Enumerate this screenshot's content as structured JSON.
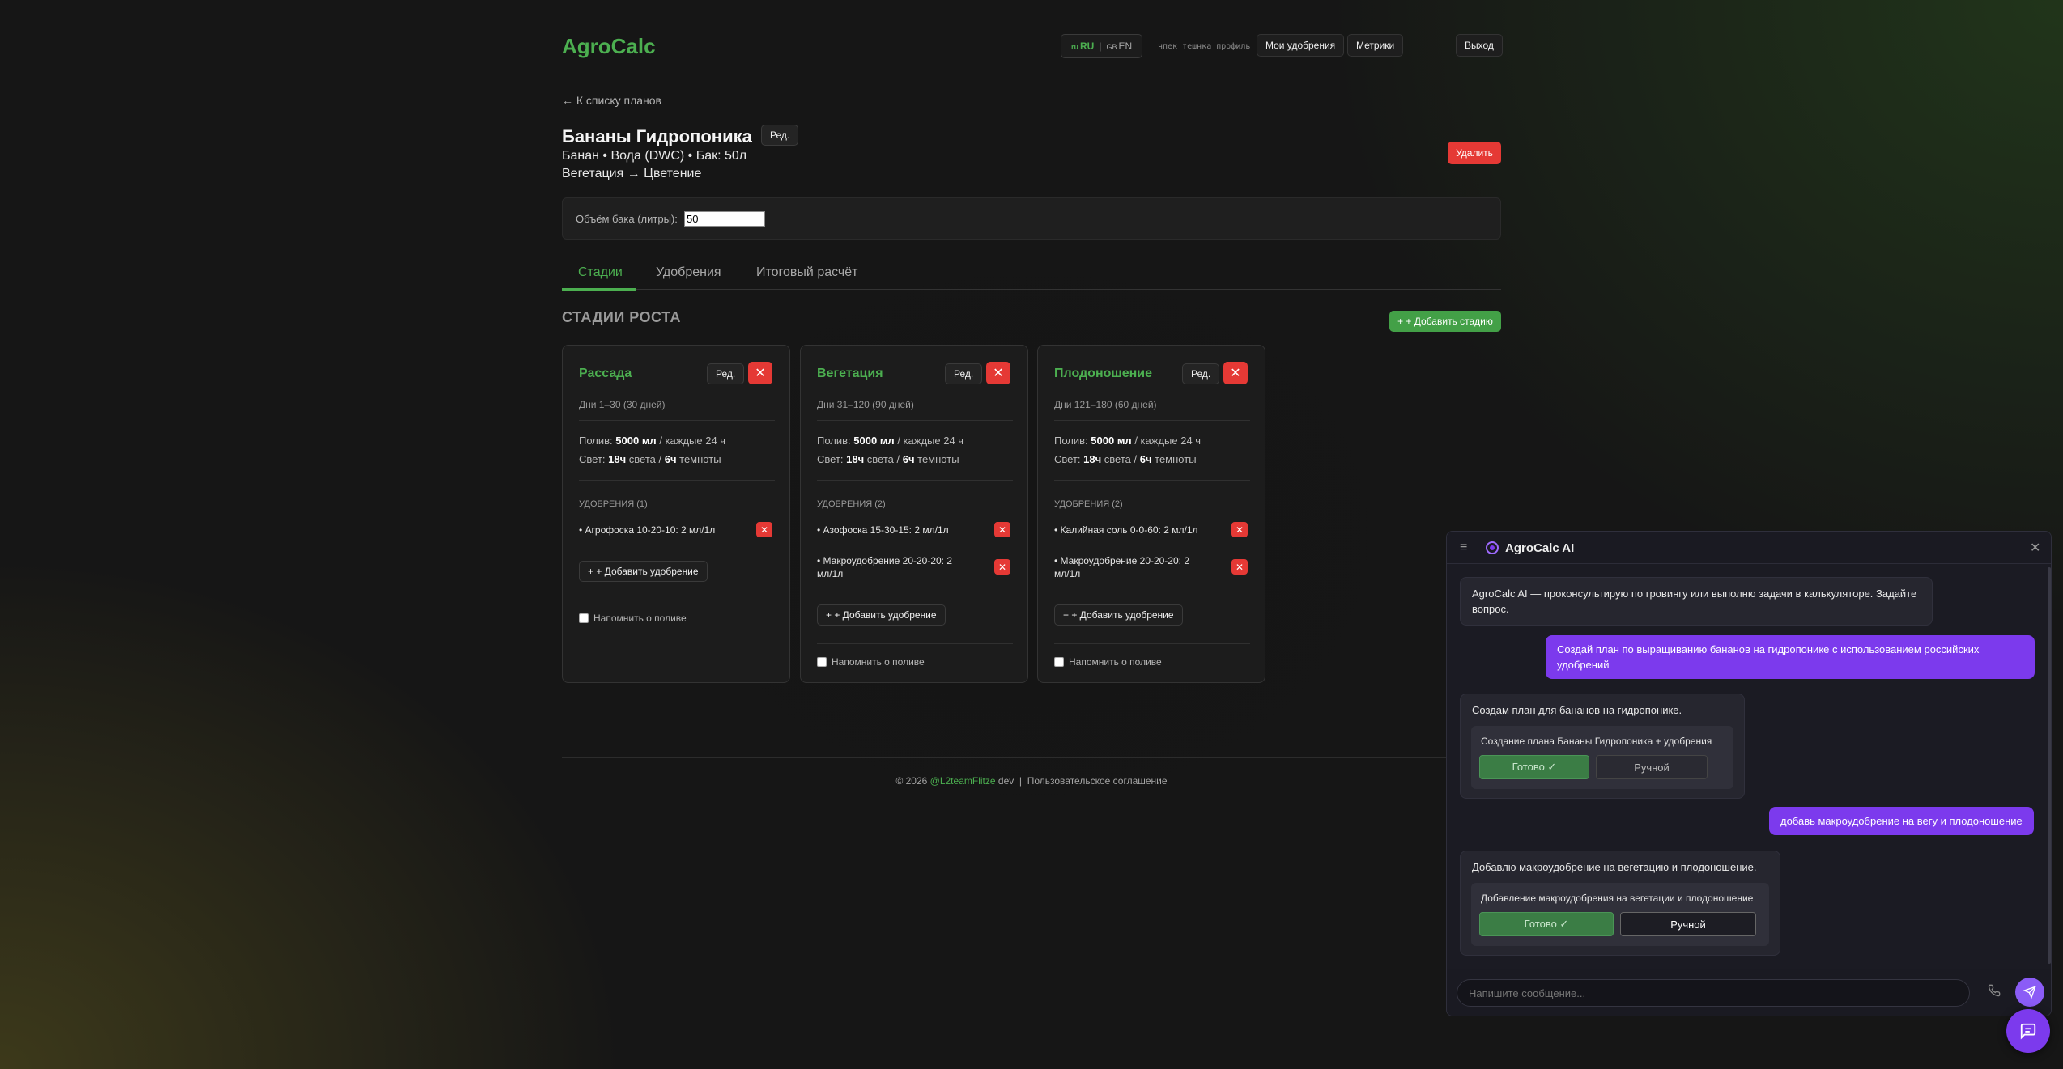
{
  "header": {
    "logo": "AgroCalc",
    "lang_ru_flag": "ru",
    "lang_ru": "RU",
    "lang_sep": "|",
    "lang_en_flag": "GB",
    "lang_en": "EN",
    "user_slug": "чпек тешнка профиль . . .",
    "nav": [
      "Мои удобрения",
      "Метрики",
      "Выход"
    ]
  },
  "back_link": "← К списку планов",
  "plan": {
    "title": "Бананы Гидропоника",
    "edit_label": "Ред.",
    "subtitle1": "Банан • Вода (DWC) • Бак: 50л",
    "subtitle2": "Вегетация → Цветение",
    "delete_label": "Удалить",
    "tank_label": "Объём бака (литры):",
    "tank_value": "50"
  },
  "tabs": [
    "Стадии",
    "Удобрения",
    "Итоговый расчёт"
  ],
  "stages_section": {
    "title": "СТАДИИ РОСТА",
    "add_stage_label": "+ + Добавить стадию"
  },
  "stages": [
    {
      "name": "Рассада",
      "edit": "Ред.",
      "delete": "✕",
      "days": "Дни 1–30 (30 дней)",
      "water_label": "Полив:",
      "water_value": "5000 мл",
      "water_suffix": "/ каждые 24 ч",
      "light_label": "Свет:",
      "light_on": "18ч",
      "light_mid": "света /",
      "light_off": "6ч",
      "light_suffix": "темноты",
      "fert_header": "УДОБРЕНИЯ (1)",
      "ferts": [
        "• Агрофоска 10-20-10: 2 мл/1л"
      ],
      "add_fert": "+ + Добавить удобрение",
      "remind": "Напомнить о поливе"
    },
    {
      "name": "Вегетация",
      "edit": "Ред.",
      "delete": "✕",
      "days": "Дни 31–120 (90 дней)",
      "water_label": "Полив:",
      "water_value": "5000 мл",
      "water_suffix": "/ каждые 24 ч",
      "light_label": "Свет:",
      "light_on": "18ч",
      "light_mid": "света /",
      "light_off": "6ч",
      "light_suffix": "темноты",
      "fert_header": "УДОБРЕНИЯ (2)",
      "ferts": [
        "• Азофоска 15-30-15: 2 мл/1л",
        "• Макроудобрение 20-20-20: 2 мл/1л"
      ],
      "add_fert": "+ + Добавить удобрение",
      "remind": "Напомнить о поливе"
    },
    {
      "name": "Плодоношение",
      "edit": "Ред.",
      "delete": "✕",
      "days": "Дни 121–180 (60 дней)",
      "water_label": "Полив:",
      "water_value": "5000 мл",
      "water_suffix": "/ каждые 24 ч",
      "light_label": "Свет:",
      "light_on": "18ч",
      "light_mid": "света /",
      "light_off": "6ч",
      "light_suffix": "темноты",
      "fert_header": "УДОБРЕНИЯ (2)",
      "ferts": [
        "• Калийная соль 0-0-60: 2 мл/1л",
        "• Макроудобрение 20-20-20: 2 мл/1л"
      ],
      "add_fert": "+ + Добавить удобрение",
      "remind": "Напомнить о поливе"
    }
  ],
  "footer": {
    "prefix": "© 2026",
    "author": "@L2teamFlitze",
    "suffix": "dev",
    "sep": "|",
    "agreement": "Пользовательское соглашение"
  },
  "chat": {
    "title": "AgroCalc AI",
    "menu_icon": "≡",
    "close_icon": "✕",
    "intro": "AgroCalc AI — проконсультирую по гровингу или выполню задачи в калькуляторе. Задайте вопрос.",
    "user_msg1": "Создай план по выращиванию бананов на гидропонике с использованием российских удобрений",
    "ai_msg2": "Создам план для бананов на гидропонике.",
    "task1_title": "Создание плана Бананы Гидропоника + удобрения",
    "task1_done": "Готово ✓",
    "task1_manual": "Ручной",
    "user_msg2": "добавь макроудобрение на вегу и плодоношение",
    "ai_msg3": "Добавлю макроудобрение на вегетацию и плодоношение.",
    "task2_title": "Добавление макроудобрения на вегетации и плодоношение",
    "task2_done": "Готово ✓",
    "task2_manual": "Ручной",
    "input_placeholder": "Напишите сообщение..."
  },
  "colors": {
    "accent": "#4caf50",
    "danger": "#e53935",
    "chat_accent": "#7c3aed"
  }
}
